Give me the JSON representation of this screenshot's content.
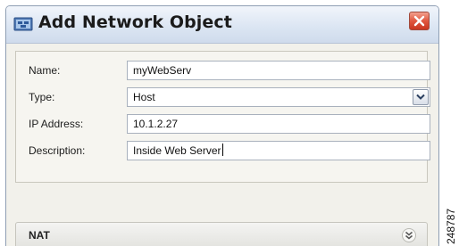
{
  "dialog": {
    "title": "Add Network Object",
    "title_icon": "network-object-icon",
    "close_icon": "close-icon"
  },
  "form": {
    "name_label": "Name:",
    "name_value": "myWebServ",
    "type_label": "Type:",
    "type_value": "Host",
    "ip_label": "IP Address:",
    "ip_value": "10.1.2.27",
    "description_label": "Description:",
    "description_value": "Inside Web Server"
  },
  "nat": {
    "label": "NAT",
    "expand_icon": "double-chevron-down-icon"
  },
  "figure_code": "248787"
}
